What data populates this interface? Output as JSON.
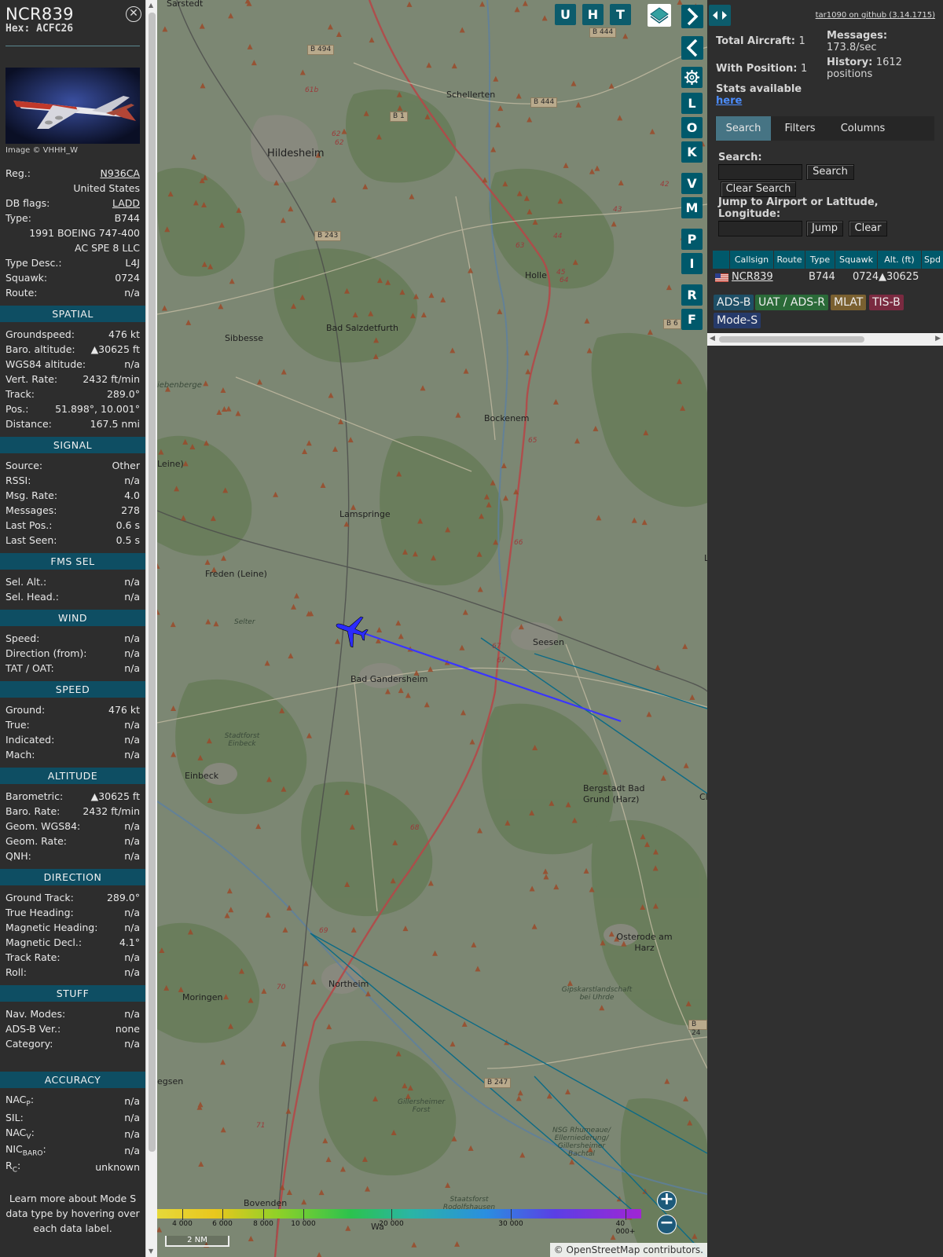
{
  "info": {
    "callsign": "NCR839",
    "hex": "Hex: ACFC26",
    "image_credit": "Image © VHHH_W",
    "general": [
      {
        "label": "Reg.:",
        "value": "N936CA",
        "link": true
      },
      {
        "label": "",
        "value": "United States"
      },
      {
        "label": "DB flags:",
        "value": "LADD",
        "link": true
      },
      {
        "label": "Type:",
        "value": "B744"
      },
      {
        "label": "",
        "value": "1991 BOEING 747-400"
      },
      {
        "label": "",
        "value": "AC SPE 8 LLC"
      },
      {
        "label": "Type Desc.:",
        "value": "L4J"
      },
      {
        "label": "Squawk:",
        "value": "0724"
      },
      {
        "label": "Route:",
        "value": "n/a"
      }
    ],
    "sections": [
      {
        "title": "SPATIAL",
        "rows": [
          {
            "label": "Groundspeed:",
            "value": "476 kt"
          },
          {
            "label": "Baro. altitude:",
            "value": "▲30625 ft"
          },
          {
            "label": "WGS84 altitude:",
            "value": "n/a"
          },
          {
            "label": "Vert. Rate:",
            "value": "2432 ft/min"
          },
          {
            "label": "Track:",
            "value": "289.0°"
          },
          {
            "label": "Pos.:",
            "value": "51.898°, 10.001°"
          },
          {
            "label": "Distance:",
            "value": "167.5 nmi"
          }
        ]
      },
      {
        "title": "SIGNAL",
        "rows": [
          {
            "label": "Source:",
            "value": "Other"
          },
          {
            "label": "RSSI:",
            "value": "n/a"
          },
          {
            "label": "Msg. Rate:",
            "value": "4.0"
          },
          {
            "label": "Messages:",
            "value": "278"
          },
          {
            "label": "Last Pos.:",
            "value": "0.6 s"
          },
          {
            "label": "Last Seen:",
            "value": "0.5 s"
          }
        ]
      },
      {
        "title": "FMS SEL",
        "rows": [
          {
            "label": "Sel. Alt.:",
            "value": "n/a"
          },
          {
            "label": "Sel. Head.:",
            "value": "n/a"
          }
        ]
      },
      {
        "title": "WIND",
        "rows": [
          {
            "label": "Speed:",
            "value": "n/a"
          },
          {
            "label": "Direction (from):",
            "value": "n/a"
          },
          {
            "label": "TAT / OAT:",
            "value": "n/a"
          }
        ]
      },
      {
        "title": "SPEED",
        "rows": [
          {
            "label": "Ground:",
            "value": "476 kt"
          },
          {
            "label": "True:",
            "value": "n/a"
          },
          {
            "label": "Indicated:",
            "value": "n/a"
          },
          {
            "label": "Mach:",
            "value": "n/a"
          }
        ]
      },
      {
        "title": "ALTITUDE",
        "rows": [
          {
            "label": "Barometric:",
            "value": "▲30625 ft"
          },
          {
            "label": "Baro. Rate:",
            "value": "2432 ft/min"
          },
          {
            "label": "Geom. WGS84:",
            "value": "n/a"
          },
          {
            "label": "Geom. Rate:",
            "value": "n/a"
          },
          {
            "label": "QNH:",
            "value": "n/a"
          }
        ]
      },
      {
        "title": "DIRECTION",
        "rows": [
          {
            "label": "Ground Track:",
            "value": "289.0°"
          },
          {
            "label": "True Heading:",
            "value": "n/a"
          },
          {
            "label": "Magnetic Heading:",
            "value": "n/a"
          },
          {
            "label": "Magnetic Decl.:",
            "value": "4.1°"
          },
          {
            "label": "Track Rate:",
            "value": "n/a"
          },
          {
            "label": "Roll:",
            "value": "n/a"
          }
        ]
      },
      {
        "title": "STUFF",
        "rows": [
          {
            "label": "Nav. Modes:",
            "value": "n/a"
          },
          {
            "label": "ADS-B Ver.:",
            "value": "none"
          },
          {
            "label": "Category:",
            "value": "n/a"
          }
        ]
      }
    ],
    "accuracy": {
      "title": "ACCURACY",
      "nacp": {
        "label": "NAC",
        "sub": "P",
        "value": "n/a"
      },
      "sil": {
        "label": "SIL:",
        "value": "n/a"
      },
      "nacv": {
        "label": "NAC",
        "sub": "V",
        "value": "n/a"
      },
      "nicbaro": {
        "label": "NIC",
        "sub": "BARO",
        "value": "n/a"
      },
      "rc": {
        "label": "R",
        "sub": "C",
        "value": "unknown"
      }
    },
    "learn_more": "Learn more about Mode S data type by hovering over each data label."
  },
  "map": {
    "places": {
      "sarstedt": "Sarstedt",
      "hildesheim": "Hildesheim",
      "schellerten": "Schellerten",
      "holle": "Holle",
      "sibbesse": "Sibbesse",
      "bad_salzdetfurth": "Bad Salzdetfurth",
      "siebenberge": "iebenberge",
      "bockenem": "Bockenem",
      "leine": "Leine)",
      "lamspringe": "Lamspringe",
      "freden": "Freden (Leine)",
      "selter": "Selter",
      "seesen": "Seesen",
      "bad_gandersheim": "Bad Gandersheim",
      "stadtforst_einbeck": "Stadtforst Einbeck",
      "einbeck": "Einbeck",
      "bergstadt": "Bergstadt Bad Grund (Harz)",
      "cl": "Cl",
      "osterode": "Osterode am Harz",
      "moringen": "Moringen",
      "northeim": "Northeim",
      "gipskarst": "Gipskarstlandschaft bei Uhrde",
      "egsen": "egsen",
      "gillersheimer": "Gillersheimer Forst",
      "nsg": "NSG Rhumeaue/ Ellerniederung/ Gillersheimer Bachtal",
      "bovenden": "Bovenden",
      "staatsforst": "Staatsforst Rodolfshausen",
      "wa": "Wa",
      "l_right": "L"
    },
    "roads": {
      "b444a": "B 444",
      "b494": "B 494",
      "b1": "B 1",
      "b444b": "B 444",
      "b243": "B 243",
      "b6": "B 6",
      "b247": "B 247",
      "b24": "B 24"
    },
    "road_nums": {
      "n61b": "61b",
      "n62": "62",
      "n62b": "62",
      "n63": "63",
      "n44": "44",
      "n43": "43",
      "n42": "42",
      "n45": "45",
      "n64": "64",
      "n65": "65",
      "n66": "66",
      "n67": "67",
      "n67b": "67",
      "n68": "68",
      "n69": "69",
      "n70": "70",
      "n71": "71"
    },
    "buttons": {
      "u": "U",
      "h": "H",
      "t": "T",
      "l": "L",
      "o": "O",
      "k": "K",
      "v": "V",
      "m": "M",
      "p": "P",
      "i": "I",
      "r": "R",
      "f": "F"
    },
    "zoom_in": "+",
    "zoom_out": "−",
    "legend_ticks": [
      "4 000",
      "6 000",
      "8 000",
      "10 000",
      "20 000",
      "30 000",
      "40 000+"
    ],
    "scale": "2 NM",
    "attribution_prefix": "© ",
    "attribution_link": "OpenStreetMap",
    "attribution_suffix": " contributors."
  },
  "sidebar": {
    "version_link": "tar1090 on github (3.14.1715)",
    "total_aircraft_label": "Total Aircraft:",
    "total_aircraft": "1",
    "with_position_label": "With Position:",
    "with_position": "1",
    "messages_label": "Messages:",
    "messages_value": "173.8/sec",
    "history_label": "History:",
    "history_value": "1612",
    "history_unit": "positions",
    "stats_label": "Stats available",
    "stats_link": "here",
    "tabs": [
      "Search",
      "Filters",
      "Columns"
    ],
    "search_label": "Search:",
    "search_button": "Search",
    "clear_search_button": "Clear Search",
    "jump_label": "Jump to Airport or Latitude, Longitude:",
    "jump_button": "Jump",
    "clear_button": "Clear",
    "table": {
      "headers": [
        "Callsign",
        "Route",
        "Type",
        "Squawk",
        "Alt. (ft)",
        "Spd"
      ],
      "row": {
        "callsign": "NCR839",
        "route": "",
        "type": "B744",
        "squawk": "0724",
        "alt": "▲30625"
      }
    },
    "sources": [
      "ADS-B",
      "UAT / ADS-R",
      "MLAT",
      "TIS-B",
      "Mode-S"
    ]
  },
  "colors": {
    "section_header": "#0e4e63",
    "button": "#00596b",
    "track_line": "#3a35ff",
    "aircraft": "#2b2bff",
    "adsb": "#1e4f66",
    "uat": "#2a6a38",
    "mlat": "#7a6030",
    "tisb": "#7a2a40",
    "modes": "#263a6a"
  }
}
